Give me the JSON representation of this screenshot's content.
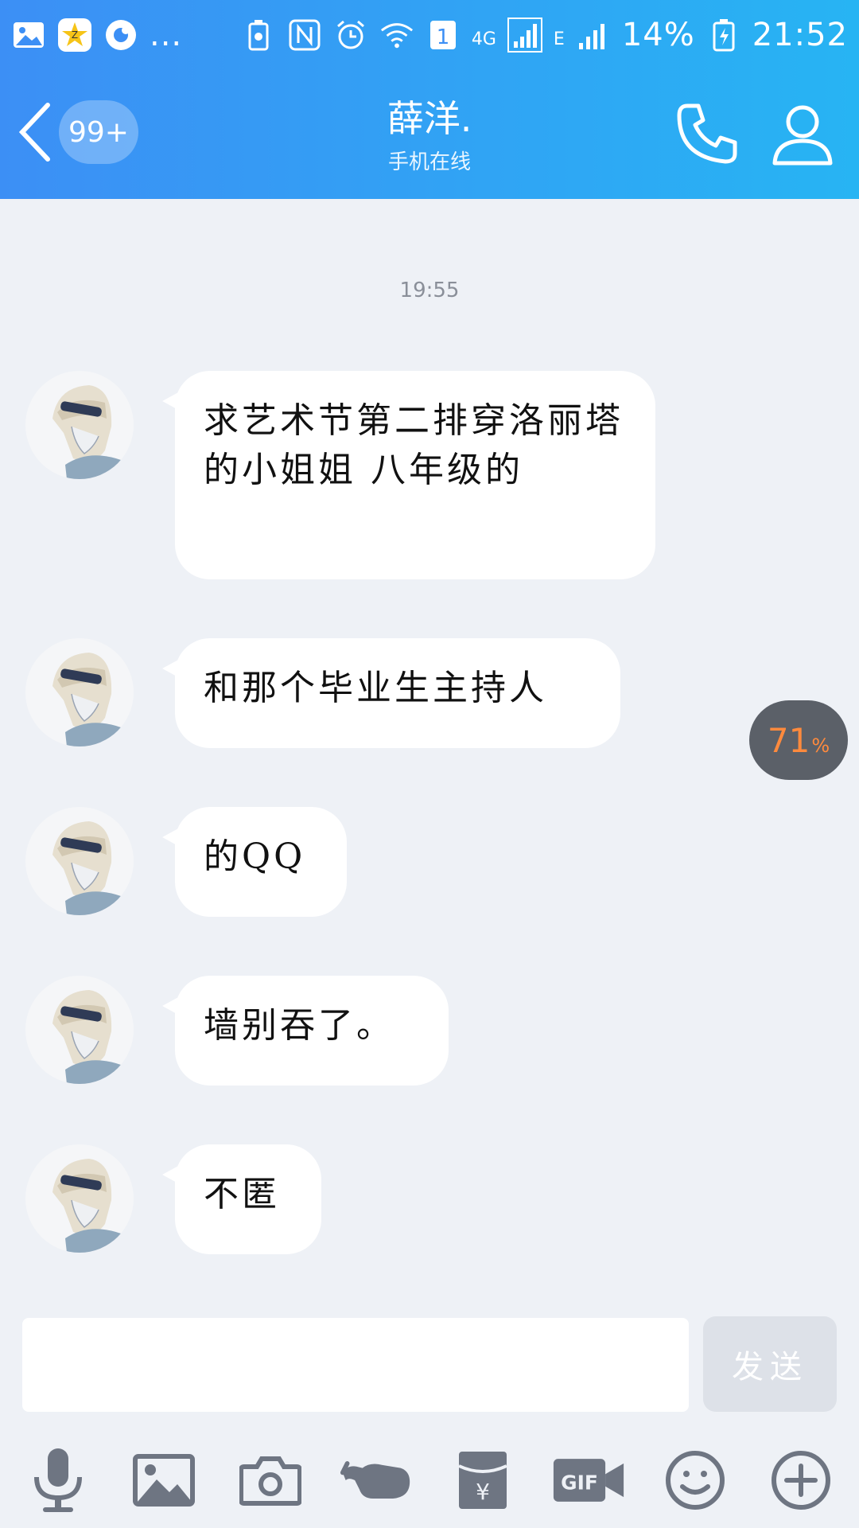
{
  "status_bar": {
    "network_1": "4G",
    "network_2": "E",
    "battery": "14%",
    "time": "21:52",
    "more": "...",
    "sim_label": "1"
  },
  "header": {
    "unread_count": "99+",
    "contact_name": "薛洋.",
    "contact_status": "手机在线"
  },
  "chat": {
    "timestamp": "19:55",
    "messages": [
      {
        "text": "求艺术节第二排穿洛丽塔的小姐姐 八年级的"
      },
      {
        "text": "和那个毕业生主持人"
      },
      {
        "text": "的QQ"
      },
      {
        "text": "墙别吞了。"
      },
      {
        "text": "不匿"
      }
    ],
    "float_badge": {
      "value": "71",
      "unit": "%"
    }
  },
  "input": {
    "placeholder": "",
    "send_label": "发送"
  },
  "colors": {
    "header_start": "#3c8ff5",
    "header_end": "#27b4f3",
    "background": "#eef1f6",
    "icon_gray": "#6e7582",
    "badge_orange": "#ff8a3d"
  },
  "toolbar_icons": [
    "microphone-icon",
    "image-icon",
    "camera-icon",
    "hand-icon",
    "red-packet-icon",
    "gif-icon",
    "emoji-icon",
    "plus-icon"
  ]
}
